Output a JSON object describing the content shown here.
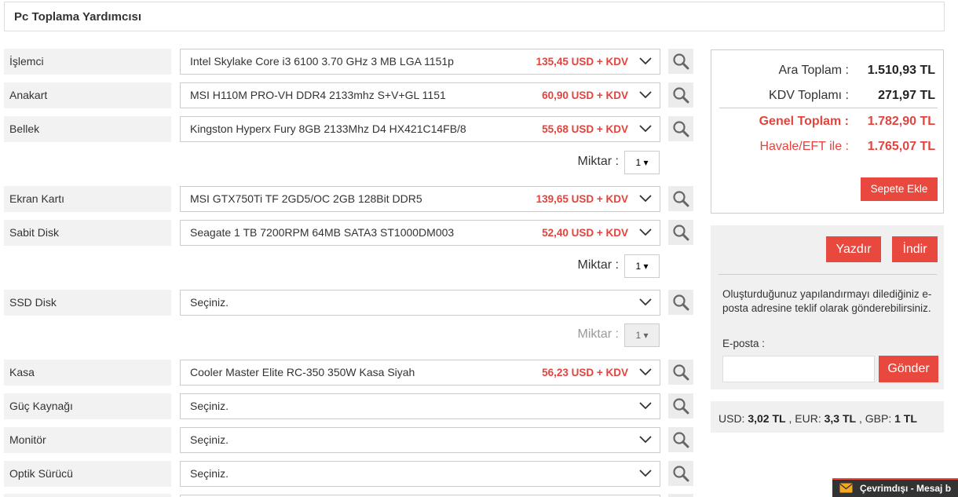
{
  "page_title": "Pc Toplama Yardımcısı",
  "rows": [
    {
      "label": "İşlemci",
      "product": "Intel Skylake Core i3 6100 3.70 GHz 3 MB LGA 1151p",
      "price": "135,45 USD + KDV"
    },
    {
      "label": "Anakart",
      "product": "MSI H110M PRO-VH DDR4 2133mhz S+V+GL 1151",
      "price": "60,90 USD + KDV"
    },
    {
      "label": "Bellek",
      "product": "Kingston Hyperx Fury 8GB 2133Mhz D4 HX421C14FB/8",
      "price": "55,68 USD + KDV"
    },
    {
      "label": "Ekran Kartı",
      "product": "MSI GTX750Ti TF 2GD5/OC 2GB 128Bit DDR5",
      "price": "139,65 USD + KDV"
    },
    {
      "label": "Sabit Disk",
      "product": "Seagate 1 TB 7200RPM 64MB SATA3 ST1000DM003",
      "price": "52,40 USD + KDV"
    },
    {
      "label": "SSD Disk",
      "product": "Seçiniz.",
      "price": ""
    },
    {
      "label": "Kasa",
      "product": "Cooler Master Elite RC-350 350W Kasa Siyah",
      "price": "56,23 USD + KDV"
    },
    {
      "label": "Güç Kaynağı",
      "product": "Seçiniz.",
      "price": ""
    },
    {
      "label": "Monitör",
      "product": "Seçiniz.",
      "price": ""
    },
    {
      "label": "Optik Sürücü",
      "product": "Seçiniz.",
      "price": ""
    }
  ],
  "quantity": {
    "label": "Miktar :",
    "memory_value": "1",
    "disk_value": "1",
    "ssd_value": "1"
  },
  "summary": {
    "subtotal_label": "Ara Toplam :",
    "subtotal_value": "1.510,93 TL",
    "tax_label": "KDV Toplamı :",
    "tax_value": "271,97 TL",
    "grand_label": "Genel Toplam :",
    "grand_value": "1.782,90 TL",
    "transfer_label": "Havale/EFT ile :",
    "transfer_value": "1.765,07 TL",
    "add_to_cart": "Sepete Ekle"
  },
  "actions": {
    "print": "Yazdır",
    "download": "İndir",
    "info": "Oluşturduğunuz yapılandırmayı dilediğiniz e-posta adresine teklif olarak gönderebilirsiniz.",
    "email_label": "E-posta :",
    "email_value": "",
    "send": "Gönder"
  },
  "currency": {
    "usd_label": "USD:",
    "usd_value": "3,02 TL",
    "eur_label": ", EUR:",
    "eur_value": "3,3 TL",
    "gbp_label": ", GBP:",
    "gbp_value": "1 TL"
  },
  "chat": {
    "text": "Çevrimdışı - Mesaj b"
  },
  "colors": {
    "accent": "#e8483d",
    "price": "#e4433d",
    "label_bg": "#f2f2f2",
    "panel_bg": "#f0f0f0"
  },
  "icons": {
    "search": "search-icon",
    "chevron": "chevron-down-icon",
    "mail": "mail-icon"
  }
}
